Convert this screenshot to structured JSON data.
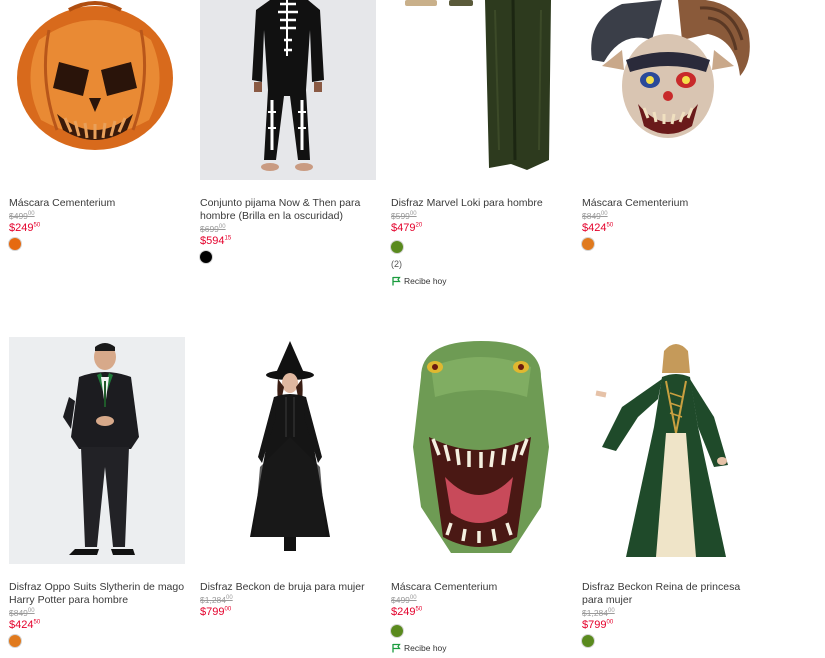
{
  "products": [
    {
      "title": "Máscara Cementerium",
      "old_price": "$499",
      "old_cents": "00",
      "price": "$249",
      "price_cents": "50",
      "swatch": "#e66a10"
    },
    {
      "title": "Conjunto pijama Now & Then para hombre (Brilla en la oscuridad)",
      "old_price": "$699",
      "old_cents": "00",
      "price": "$594",
      "price_cents": "15",
      "swatch": "#000000"
    },
    {
      "title": "Disfraz Marvel Loki para hombre",
      "old_price": "$599",
      "old_cents": "00",
      "price": "$479",
      "price_cents": "20",
      "swatch": "#5a8a1e",
      "reviews": "(2)",
      "shipping": "Recibe hoy"
    },
    {
      "title": "Máscara Cementerium",
      "old_price": "$849",
      "old_cents": "00",
      "price": "$424",
      "price_cents": "50",
      "swatch": "#e07a1e"
    },
    {
      "title": "Disfraz Oppo Suits Slytherin de mago Harry Potter para hombre",
      "old_price": "$849",
      "old_cents": "00",
      "price": "$424",
      "price_cents": "50",
      "swatch": "#e07a1e"
    },
    {
      "title": "Disfraz Beckon de bruja para mujer",
      "old_price": "$1,284",
      "old_cents": "00",
      "price": "$799",
      "price_cents": "00"
    },
    {
      "title": "Máscara Cementerium",
      "old_price": "$499",
      "old_cents": "00",
      "price": "$249",
      "price_cents": "50",
      "swatch": "#5a8a1e",
      "shipping": "Recibe hoy"
    },
    {
      "title": "Disfraz Beckon Reina de princesa para mujer",
      "old_price": "$1,284",
      "old_cents": "00",
      "price": "$799",
      "price_cents": "00",
      "swatch": "#5a8a1e"
    }
  ],
  "colors": {
    "price_red": "#e4002b",
    "shipping_green": "#1a9c3e"
  }
}
